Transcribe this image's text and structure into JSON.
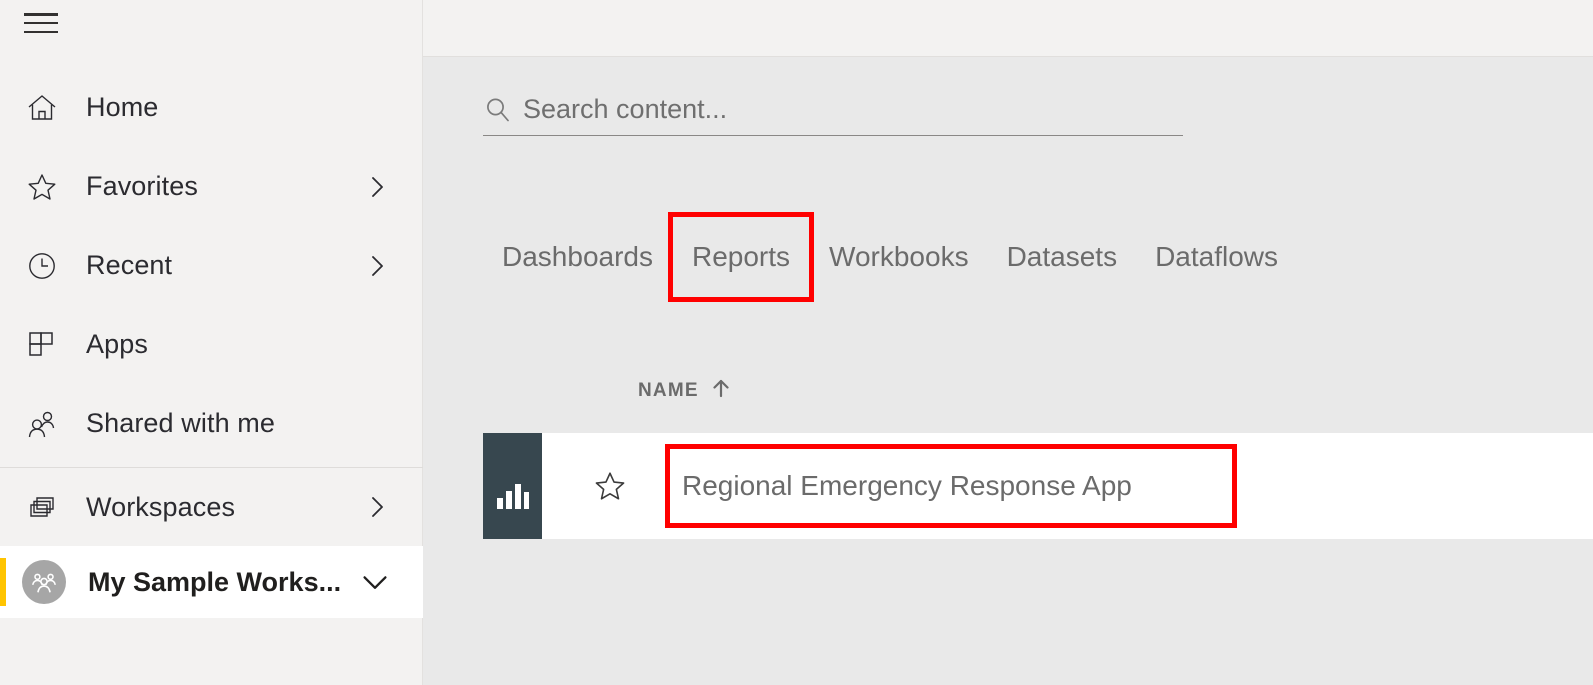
{
  "app": {
    "name": "Power BI Service",
    "accent_yellow": "#ffc400",
    "highlight_red": "#ff0000",
    "thumb_color": "#37474f"
  },
  "sidebar": {
    "menu_button": "hamburger-menu",
    "items": [
      {
        "label": "Home",
        "icon": "home-icon",
        "has_chevron": false
      },
      {
        "label": "Favorites",
        "icon": "star-icon",
        "has_chevron": true
      },
      {
        "label": "Recent",
        "icon": "clock-icon",
        "has_chevron": true
      },
      {
        "label": "Apps",
        "icon": "apps-grid-icon",
        "has_chevron": false
      },
      {
        "label": "Shared with me",
        "icon": "people-icon",
        "has_chevron": false
      }
    ],
    "workspaces": {
      "label": "Workspaces",
      "icon": "stacked-windows-icon",
      "has_chevron": true
    },
    "selected_workspace": {
      "label": "My Sample Works...",
      "avatar_icon": "group-avatar-icon",
      "chevron": "chevron-down-icon",
      "selected": true
    }
  },
  "search": {
    "placeholder": "Search content...",
    "value": "",
    "icon": "search-icon"
  },
  "tabs": [
    {
      "label": "Dashboards",
      "highlighted": false
    },
    {
      "label": "Reports",
      "highlighted": true
    },
    {
      "label": "Workbooks",
      "highlighted": false
    },
    {
      "label": "Datasets",
      "highlighted": false
    },
    {
      "label": "Dataflows",
      "highlighted": false
    }
  ],
  "table": {
    "columns": [
      {
        "label": "NAME",
        "sort": "ascending",
        "sort_icon": "arrow-up-icon"
      }
    ],
    "rows": [
      {
        "name": "Regional Emergency Response App",
        "thumbnail_icon": "bar-chart-icon",
        "favorite_icon": "star-outline-icon",
        "favorited": false,
        "highlighted": true
      }
    ]
  }
}
